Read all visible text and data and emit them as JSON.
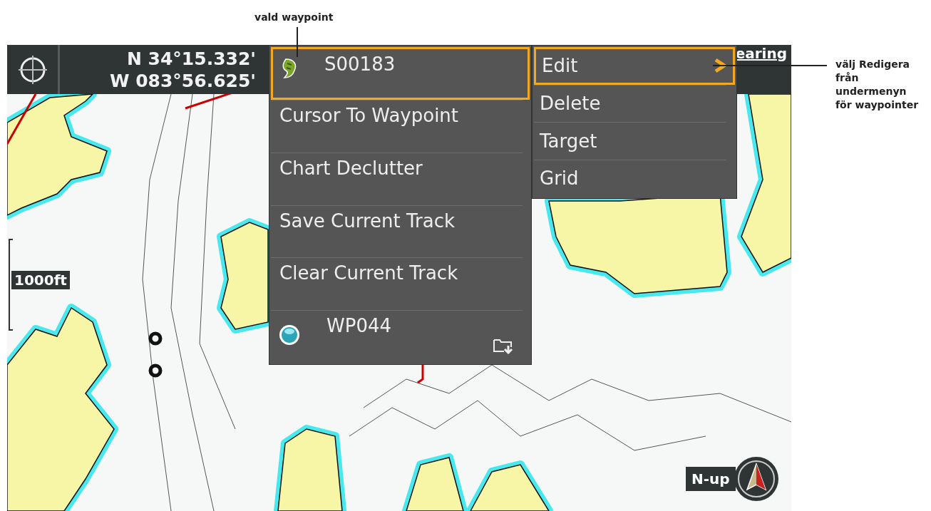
{
  "annotations": [
    {
      "kind": "top",
      "lines": [
        "vald waypoint"
      ]
    },
    {
      "kind": "side",
      "lines": [
        "välj Redigera",
        "från",
        "undermenyn",
        "för waypointer"
      ]
    }
  ],
  "status_bar": {
    "latitude": "N 34°15.332'",
    "longitude": "W 083°56.625'",
    "field_label": "earing"
  },
  "menu": {
    "items": [
      {
        "kind": "fish-waypoint",
        "label": "S00183",
        "selected": true
      },
      {
        "kind": "action",
        "label": "Cursor To Waypoint",
        "selected": false
      },
      {
        "kind": "action",
        "label": "Chart Declutter",
        "selected": false
      },
      {
        "kind": "action",
        "label": "Save Current Track",
        "selected": false
      },
      {
        "kind": "action",
        "label": "Clear Current Track",
        "selected": false
      },
      {
        "kind": "dot-waypoint",
        "label": "WP044",
        "selected": false
      }
    ]
  },
  "submenu": {
    "items": [
      {
        "label": "Edit",
        "selected": true
      },
      {
        "label": "Delete",
        "selected": false
      },
      {
        "label": "Target",
        "selected": false
      },
      {
        "label": "Grid",
        "selected": false
      }
    ]
  },
  "scale": "1000ft",
  "orientation": "N-up"
}
